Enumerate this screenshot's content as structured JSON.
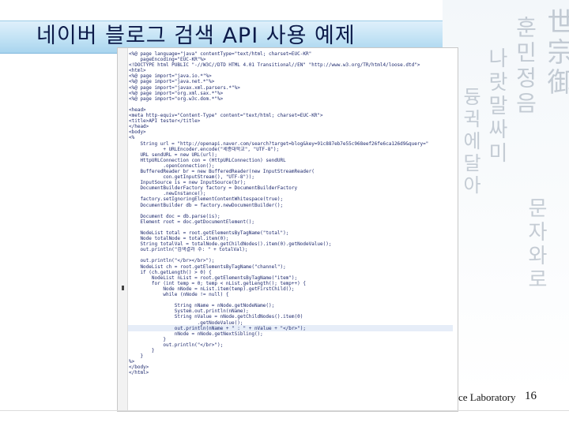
{
  "slide": {
    "title": "네이버 블로그 검색 API 사용 예제",
    "footer_lab": "ce Laboratory",
    "page_number": "16"
  },
  "calligraphy": [
    "世宗御",
    "훈민정음",
    "나랏말싸미",
    "듕귁에달아",
    "문자와로"
  ],
  "code_lines": [
    "<%@ page language=\"java\" contentType=\"text/html; charset=EUC-KR\"",
    "    pageEncoding=\"EUC-KR\"%>",
    "<!DOCTYPE html PUBLIC \"-//W3C//DTD HTML 4.01 Transitional//EN\" \"http://www.w3.org/TR/html4/loose.dtd\">",
    "<html>",
    "<%@ page import=\"java.io.*\"%>",
    "<%@ page import=\"java.net.*\"%>",
    "<%@ page import=\"javax.xml.parsers.*\"%>",
    "<%@ page import=\"org.xml.sax.*\"%>",
    "<%@ page import=\"org.w3c.dom.*\"%>",
    "",
    "<head>",
    "<meta http-equiv=\"Content-Type\" content=\"text/html; charset=EUC-KR\">",
    "<title>API tester</title>",
    "</head>",
    "<body>",
    "<%",
    "    String url = \"http://openapi.naver.com/search?target=blog&key=91c887eb7e55c968eef26fe6ca126d9&query=\"",
    "            + URLEncoder.encode(\"세종대학교\", \"UTF-8\");",
    "    URL sendURL = new URL(url);",
    "    HttpURLConnection con = (HttpURLConnection) sendURL",
    "            .openConnection();",
    "    BufferedReader br = new BufferedReader(new InputStreamReader(",
    "            con.getInputStream(), \"UTF-8\"));",
    "    InputSource is = new InputSource(br);",
    "    DocumentBuilderFactory factory = DocumentBuilderFactory",
    "            .newInstance();",
    "    factory.setIgnoringElementContentWhitespace(true);",
    "    DocumentBuilder db = factory.newDocumentBuilder();",
    "",
    "    Document doc = db.parse(is);",
    "    Element root = doc.getDocumentElement();",
    "",
    "    NodeList total = root.getElementsByTagName(\"total\");",
    "    Node totalNode = total.item(0);",
    "    String totalVal = totalNode.getChildNodes().item(0).getNodeValue();",
    "    out.println(\"검색결과 수: \" + totalVal);",
    "",
    "    out.println(\"</br></br>\");",
    "    NodeList ch = root.getElementsByTagName(\"channel\");",
    "    if (ch.getLength() > 0) {",
    "        NodeList nList = root.getElementsByTagName(\"item\");",
    "        for (int temp = 0; temp < nList.getLength(); temp++) {",
    "            Node nNode = nList.item(temp).getFirstChild();",
    "            while (nNode != null) {",
    "",
    "                String nName = nNode.getNodeName();",
    "                System.out.println(nName);",
    "                String nValue = nNode.getChildNodes().item(0)",
    "                        .getNodeValue();",
    "                out.println(nName + \" : \" + nValue + \"</br>\");",
    "                nNode = nNode.getNextSibling();",
    "            }",
    "            out.println(\"</br>\");",
    "        }",
    "    }",
    "%>",
    "</body>",
    "</html>"
  ]
}
